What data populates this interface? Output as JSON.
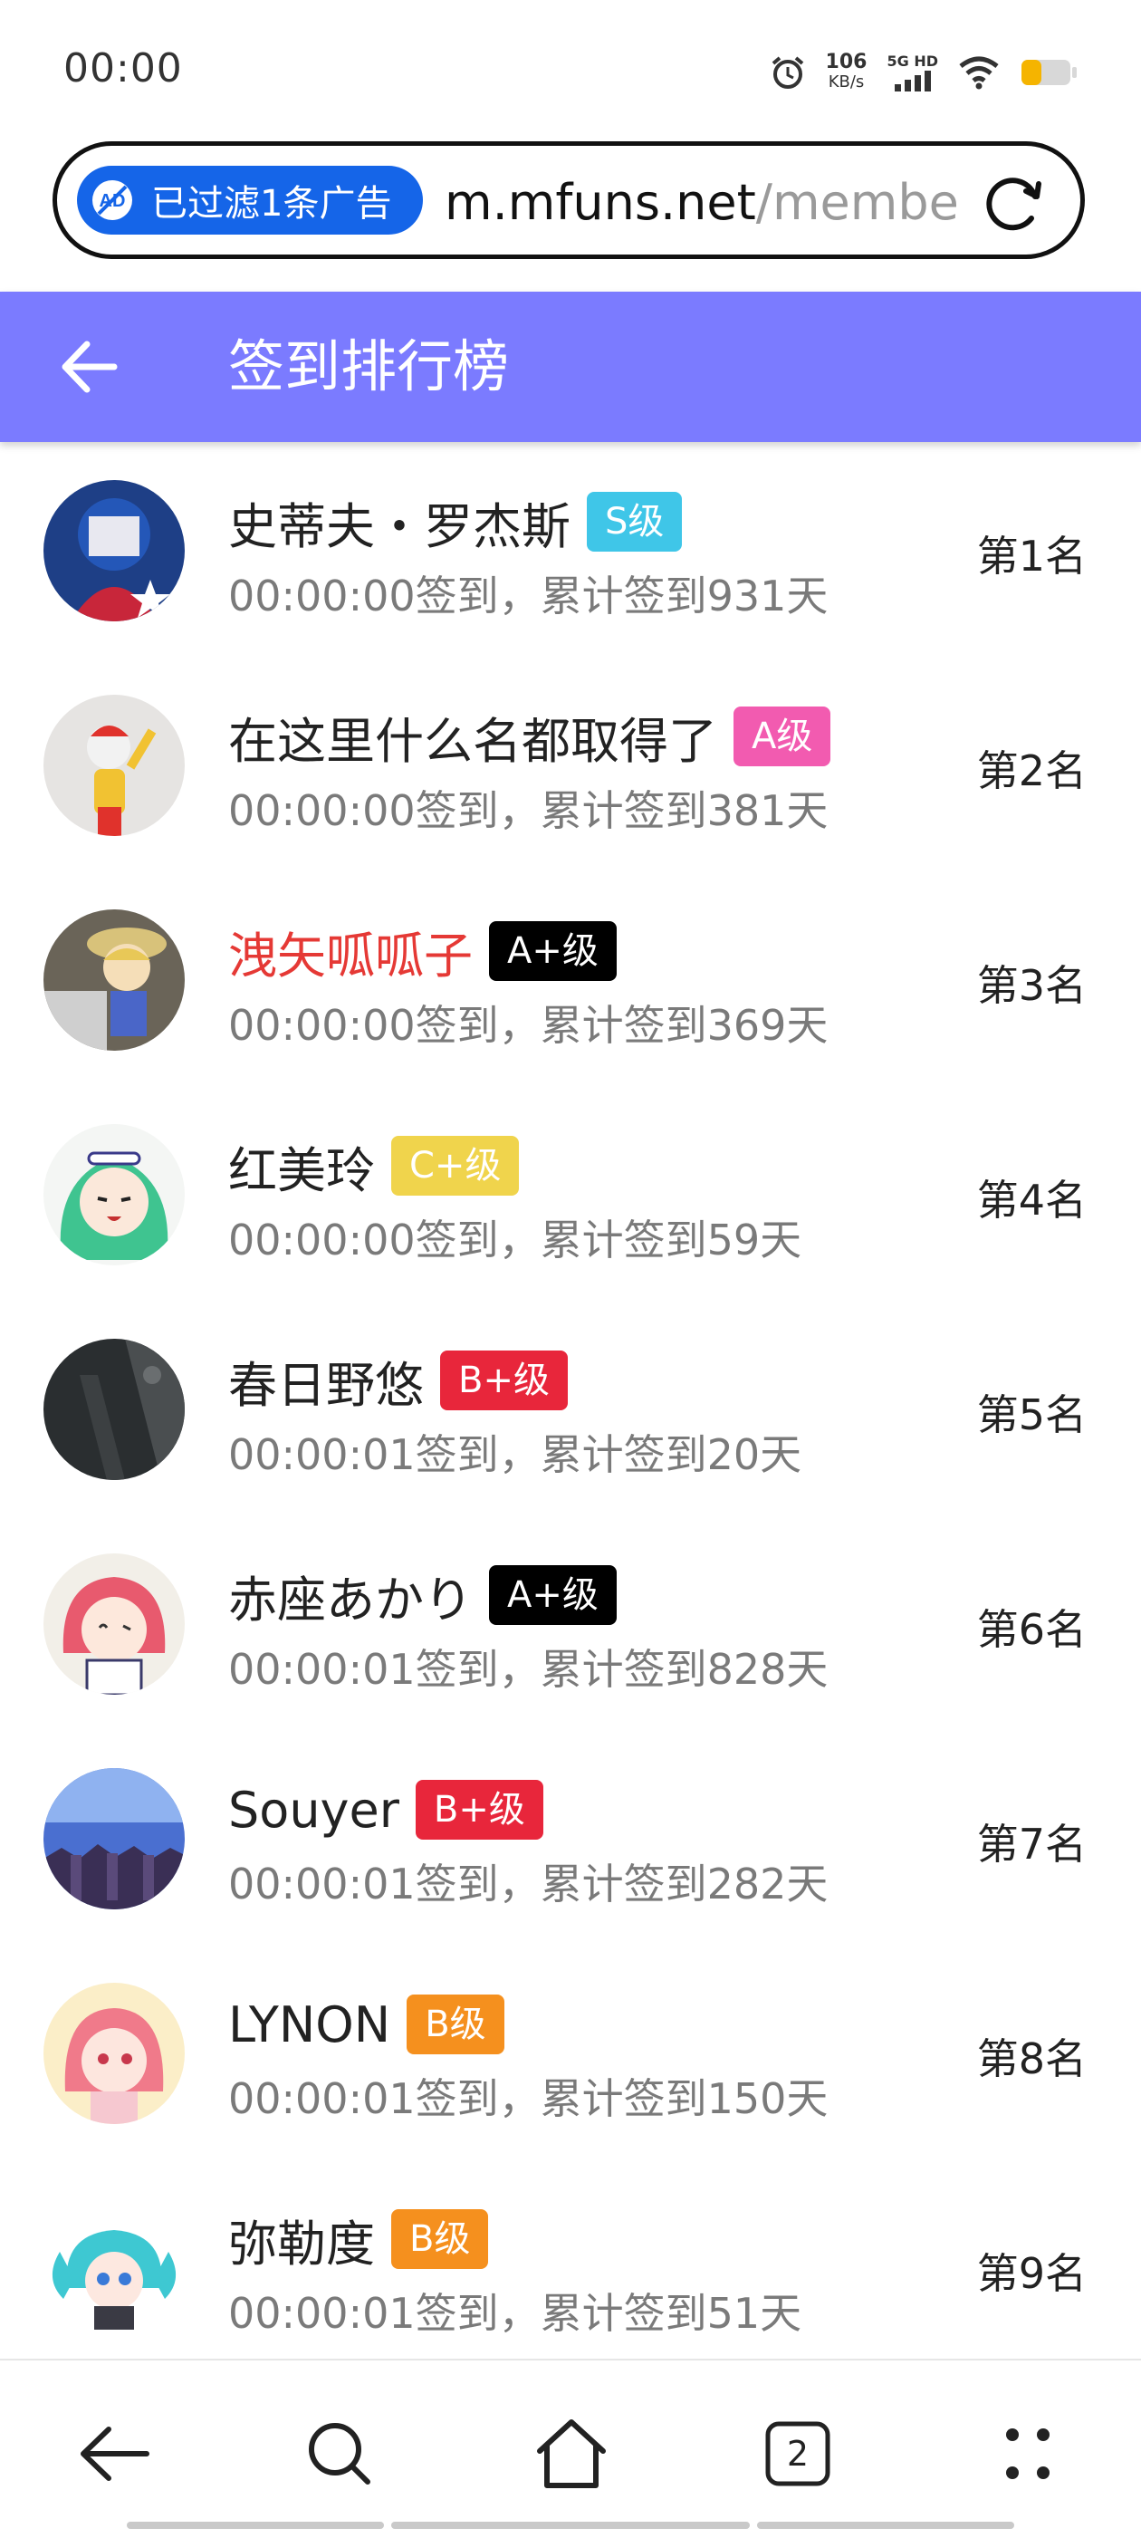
{
  "status_bar": {
    "time": "00:00",
    "speed_value": "106",
    "speed_unit": "KB/s",
    "network": "5G HD",
    "icons": [
      "alarm-icon",
      "signal-icon",
      "wifi-icon",
      "battery-icon"
    ]
  },
  "browser": {
    "ad_filter_label": "已过滤1条广告",
    "url_host": "m.mfuns.net",
    "url_path": "/membe",
    "ad_icon": "ad-block-icon",
    "reload_icon": "reload-icon"
  },
  "header": {
    "title": "签到排行榜",
    "back_icon": "back-arrow-icon",
    "color": "#7b7bff"
  },
  "ranking": [
    {
      "name": "史蒂夫・罗杰斯",
      "name_color": "#222222",
      "badge": "S级",
      "badge_color": "#3fc6e8",
      "checkin": "00:00:00签到，累计签到931天",
      "rank": "第1名"
    },
    {
      "name": "在这里什么名都取得了",
      "name_color": "#222222",
      "badge": "A级",
      "badge_color": "#f25bb0",
      "checkin": "00:00:00签到，累计签到381天",
      "rank": "第2名"
    },
    {
      "name": "洩矢呱呱子",
      "name_color": "#e53935",
      "badge": "A+级",
      "badge_color": "#000000",
      "checkin": "00:00:00签到，累计签到369天",
      "rank": "第3名"
    },
    {
      "name": "红美玲",
      "name_color": "#222222",
      "badge": "C+级",
      "badge_color": "#f0d44c",
      "checkin": "00:00:00签到，累计签到59天",
      "rank": "第4名"
    },
    {
      "name": "春日野悠",
      "name_color": "#222222",
      "badge": "B+级",
      "badge_color": "#e8263b",
      "checkin": "00:00:01签到，累计签到20天",
      "rank": "第5名"
    },
    {
      "name": "赤座あかり",
      "name_color": "#222222",
      "badge": "A+级",
      "badge_color": "#000000",
      "checkin": "00:00:01签到，累计签到828天",
      "rank": "第6名"
    },
    {
      "name": "Souyer",
      "name_color": "#222222",
      "badge": "B+级",
      "badge_color": "#e8263b",
      "checkin": "00:00:01签到，累计签到282天",
      "rank": "第7名"
    },
    {
      "name": "LYNON",
      "name_color": "#222222",
      "badge": "B级",
      "badge_color": "#f5901e",
      "checkin": "00:00:01签到，累计签到150天",
      "rank": "第8名"
    },
    {
      "name": "弥勒度",
      "name_color": "#222222",
      "badge": "B级",
      "badge_color": "#f5901e",
      "checkin": "00:00:01签到，累计签到51天",
      "rank": "第9名"
    }
  ],
  "bottom_nav": {
    "tab_count": "2",
    "icons": [
      "back-icon",
      "search-icon",
      "home-icon",
      "tabs-icon",
      "more-icon"
    ]
  }
}
